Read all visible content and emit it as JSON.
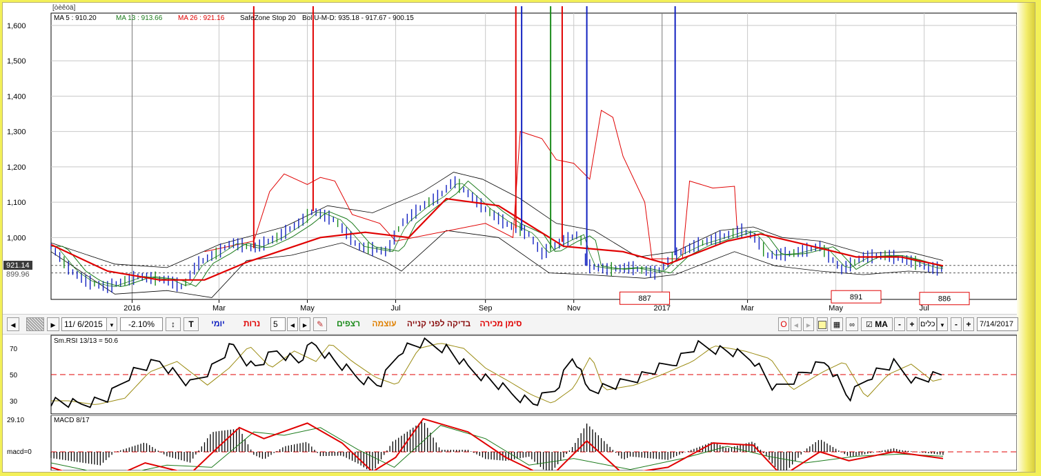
{
  "header": {
    "title": "[òèêöä]",
    "ma5": "MA 5 : 910.20",
    "ma13": "MA 13 : 913.66",
    "ma26": "MA 26 : 921.16",
    "safezone": "SafeZone Stop 20",
    "bol": "Bol U-M-D: 935.18 - 917.67 - 900.15"
  },
  "price_labels": {
    "last": "921.14",
    "low": "899.96"
  },
  "toolbar": {
    "date_from": "11/ 6/2015",
    "change": "-2.10%",
    "t_label": "T",
    "daily": "יומי",
    "candles": "נרות",
    "period": "5",
    "continuous": "רצפים",
    "strength": "עוצמה",
    "pre_buy_check": "בדיקה לפני קנייה",
    "sell_sign": "סימן מכירה",
    "o_label": "O",
    "ma_label": "MA",
    "minus": "-",
    "plus": "+",
    "tools": "כלים",
    "date_to": "7/14/2017",
    "nav_left": "◀",
    "nav_right": "▶"
  },
  "colors": {
    "ma5": "#1a7a1a",
    "ma13": "#1a7a1a",
    "ma26": "#e00000",
    "bar": "#1020c0",
    "bar_alt": "#1a8a1a",
    "safezone": "#e00000",
    "bollinger": "#000000"
  },
  "chart_data": [
    {
      "type": "line",
      "panel": "price",
      "yticks": [
        1600,
        1500,
        1400,
        1300,
        1200,
        1100,
        1000
      ],
      "ytick_labels": [
        "1,600",
        "1,500",
        "1,400",
        "1,300",
        "1,200",
        "1,100",
        "1,000"
      ],
      "ylim": [
        825,
        1635
      ],
      "x_labels": [
        {
          "label": "2016",
          "date": "2016-01-01"
        },
        {
          "label": "Mar",
          "date": "2016-03-01"
        },
        {
          "label": "May",
          "date": "2016-05-01"
        },
        {
          "label": "Jul",
          "date": "2016-07-01"
        },
        {
          "label": "Sep",
          "date": "2016-09-01"
        },
        {
          "label": "Nov",
          "date": "2016-11-01"
        },
        {
          "label": "2017",
          "date": "2017-01-01"
        },
        {
          "label": "Mar",
          "date": "2017-03-01"
        },
        {
          "label": "May",
          "date": "2017-05-01"
        },
        {
          "label": "Jul",
          "date": "2017-07-01"
        }
      ],
      "xlim": [
        "2015-11-06",
        "2017-09-03"
      ],
      "close": [
        [
          "2015-11-06",
          975
        ],
        [
          "2015-11-20",
          905
        ],
        [
          "2015-12-01",
          875
        ],
        [
          "2015-12-15",
          860
        ],
        [
          "2016-01-05",
          890
        ],
        [
          "2016-01-25",
          880
        ],
        [
          "2016-02-05",
          860
        ],
        [
          "2016-02-15",
          925
        ],
        [
          "2016-02-28",
          955
        ],
        [
          "2016-03-10",
          985
        ],
        [
          "2016-03-25",
          970
        ],
        [
          "2016-04-10",
          1000
        ],
        [
          "2016-04-25",
          1040
        ],
        [
          "2016-05-05",
          1075
        ],
        [
          "2016-05-20",
          1050
        ],
        [
          "2016-06-05",
          975
        ],
        [
          "2016-06-25",
          960
        ],
        [
          "2016-07-05",
          1040
        ],
        [
          "2016-07-20",
          1090
        ],
        [
          "2016-08-01",
          1120
        ],
        [
          "2016-08-10",
          1160
        ],
        [
          "2016-08-20",
          1125
        ],
        [
          "2016-09-01",
          1080
        ],
        [
          "2016-09-15",
          1040
        ],
        [
          "2016-10-01",
          1010
        ],
        [
          "2016-10-10",
          955
        ],
        [
          "2016-10-25",
          990
        ],
        [
          "2016-11-05",
          1010
        ],
        [
          "2016-11-10",
          920
        ],
        [
          "2016-11-25",
          910
        ],
        [
          "2016-12-10",
          915
        ],
        [
          "2016-12-28",
          900
        ],
        [
          "2017-01-10",
          950
        ],
        [
          "2017-01-25",
          980
        ],
        [
          "2017-02-10",
          1000
        ],
        [
          "2017-02-25",
          1020
        ],
        [
          "2017-03-05",
          1005
        ],
        [
          "2017-03-15",
          950
        ],
        [
          "2017-04-01",
          955
        ],
        [
          "2017-04-20",
          975
        ],
        [
          "2017-05-05",
          910
        ],
        [
          "2017-05-20",
          945
        ],
        [
          "2017-06-05",
          950
        ],
        [
          "2017-06-20",
          935
        ],
        [
          "2017-07-05",
          915
        ],
        [
          "2017-07-14",
          910
        ]
      ],
      "ma26": [
        [
          "2015-11-06",
          980
        ],
        [
          "2015-12-15",
          905
        ],
        [
          "2016-01-20",
          880
        ],
        [
          "2016-02-20",
          880
        ],
        [
          "2016-03-20",
          930
        ],
        [
          "2016-05-10",
          1000
        ],
        [
          "2016-06-10",
          1015
        ],
        [
          "2016-07-10",
          1000
        ],
        [
          "2016-08-05",
          1110
        ],
        [
          "2016-09-10",
          1090
        ],
        [
          "2016-10-25",
          975
        ],
        [
          "2016-12-05",
          960
        ],
        [
          "2017-01-05",
          925
        ],
        [
          "2017-02-15",
          990
        ],
        [
          "2017-03-10",
          1010
        ],
        [
          "2017-04-10",
          980
        ],
        [
          "2017-05-15",
          945
        ],
        [
          "2017-06-15",
          945
        ],
        [
          "2017-07-14",
          920
        ]
      ],
      "bollinger_upper": [
        [
          "2015-11-06",
          985
        ],
        [
          "2015-12-20",
          925
        ],
        [
          "2016-01-25",
          915
        ],
        [
          "2016-03-01",
          980
        ],
        [
          "2016-04-15",
          1030
        ],
        [
          "2016-05-15",
          1090
        ],
        [
          "2016-06-15",
          1070
        ],
        [
          "2016-07-20",
          1130
        ],
        [
          "2016-08-10",
          1185
        ],
        [
          "2016-08-30",
          1165
        ],
        [
          "2016-09-25",
          1110
        ],
        [
          "2016-10-20",
          1040
        ],
        [
          "2016-11-15",
          1020
        ],
        [
          "2016-12-15",
          945
        ],
        [
          "2017-01-10",
          960
        ],
        [
          "2017-02-10",
          1020
        ],
        [
          "2017-03-05",
          1030
        ],
        [
          "2017-03-25",
          1000
        ],
        [
          "2017-04-20",
          990
        ],
        [
          "2017-05-20",
          955
        ],
        [
          "2017-06-20",
          960
        ],
        [
          "2017-07-14",
          935
        ]
      ],
      "bollinger_lower": [
        [
          "2015-11-06",
          960
        ],
        [
          "2015-12-20",
          840
        ],
        [
          "2016-01-25",
          850
        ],
        [
          "2016-02-25",
          830
        ],
        [
          "2016-03-20",
          935
        ],
        [
          "2016-04-20",
          950
        ],
        [
          "2016-05-25",
          985
        ],
        [
          "2016-06-25",
          930
        ],
        [
          "2016-07-05",
          905
        ],
        [
          "2016-08-05",
          1020
        ],
        [
          "2016-09-10",
          1000
        ],
        [
          "2016-10-15",
          900
        ],
        [
          "2016-11-10",
          895
        ],
        [
          "2016-12-20",
          885
        ],
        [
          "2017-01-10",
          895
        ],
        [
          "2017-02-20",
          960
        ],
        [
          "2017-03-20",
          920
        ],
        [
          "2017-04-20",
          905
        ],
        [
          "2017-05-20",
          895
        ],
        [
          "2017-06-20",
          905
        ],
        [
          "2017-07-14",
          900
        ]
      ],
      "safezone_stop": [
        [
          "2016-02-20",
          960
        ],
        [
          "2016-03-25",
          990
        ],
        [
          "2016-04-05",
          1130
        ],
        [
          "2016-04-15",
          1180
        ],
        [
          "2016-05-01",
          1150
        ],
        [
          "2016-05-10",
          1170
        ],
        [
          "2016-05-20",
          1160
        ],
        [
          "2016-06-01",
          1065
        ],
        [
          "2016-06-20",
          1040
        ],
        [
          "2016-07-01",
          990
        ],
        [
          "2016-09-01",
          1040
        ],
        [
          "2016-09-20",
          1000
        ],
        [
          "2016-09-25",
          1300
        ],
        [
          "2016-10-10",
          1280
        ],
        [
          "2016-10-20",
          1220
        ],
        [
          "2016-11-01",
          1210
        ],
        [
          "2016-11-12",
          1165
        ],
        [
          "2016-11-20",
          1360
        ],
        [
          "2016-11-28",
          1340
        ],
        [
          "2016-12-05",
          1230
        ],
        [
          "2016-12-20",
          1100
        ],
        [
          "2016-12-25",
          940
        ],
        [
          "2017-01-15",
          940
        ],
        [
          "2017-01-20",
          1160
        ],
        [
          "2017-02-05",
          1140
        ],
        [
          "2017-02-20",
          1145
        ],
        [
          "2017-02-22",
          1010
        ]
      ],
      "signal_lines": [
        {
          "date": "2016-03-25",
          "color": "#e00000"
        },
        {
          "date": "2016-05-05",
          "color": "#e00000"
        },
        {
          "date": "2016-09-22",
          "color": "#e00000"
        },
        {
          "date": "2016-09-26",
          "color": "#1020c0"
        },
        {
          "date": "2016-10-16",
          "color": "#1a8a1a"
        },
        {
          "date": "2016-10-24",
          "color": "#e00000"
        },
        {
          "date": "2016-11-10",
          "color": "#1020c0"
        },
        {
          "date": "2017-01-10",
          "color": "#1020c0"
        }
      ],
      "annotations": [
        {
          "label": "887",
          "date": "2016-12-20",
          "y": 887
        },
        {
          "label": "891",
          "date": "2017-05-15",
          "y": 891
        },
        {
          "label": "886",
          "date": "2017-07-15",
          "y": 886
        }
      ],
      "dashed_levels": [
        921.14,
        899.96
      ]
    },
    {
      "type": "line",
      "panel": "rsi",
      "title": "Sm.RSI 13/13 = 50.6",
      "yticks": [
        70,
        50,
        30
      ],
      "ylim": [
        20,
        80
      ],
      "reference_level": 50,
      "values": [
        [
          "2015-11-06",
          30
        ],
        [
          "2015-11-25",
          27
        ],
        [
          "2015-12-15",
          32
        ],
        [
          "2016-01-01",
          52
        ],
        [
          "2016-01-20",
          60
        ],
        [
          "2016-02-10",
          42
        ],
        [
          "2016-02-25",
          55
        ],
        [
          "2016-03-10",
          72
        ],
        [
          "2016-03-25",
          55
        ],
        [
          "2016-04-10",
          68
        ],
        [
          "2016-04-25",
          60
        ],
        [
          "2016-05-05",
          74
        ],
        [
          "2016-05-20",
          60
        ],
        [
          "2016-06-05",
          48
        ],
        [
          "2016-06-20",
          42
        ],
        [
          "2016-07-05",
          70
        ],
        [
          "2016-07-20",
          74
        ],
        [
          "2016-08-05",
          70
        ],
        [
          "2016-08-20",
          55
        ],
        [
          "2016-09-05",
          45
        ],
        [
          "2016-09-20",
          35
        ],
        [
          "2016-10-05",
          28
        ],
        [
          "2016-10-20",
          40
        ],
        [
          "2016-11-01",
          65
        ],
        [
          "2016-11-10",
          38
        ],
        [
          "2016-12-01",
          42
        ],
        [
          "2016-12-20",
          50
        ],
        [
          "2017-01-10",
          60
        ],
        [
          "2017-01-25",
          72
        ],
        [
          "2017-02-15",
          68
        ],
        [
          "2017-03-05",
          62
        ],
        [
          "2017-03-20",
          38
        ],
        [
          "2017-04-10",
          52
        ],
        [
          "2017-04-25",
          60
        ],
        [
          "2017-05-10",
          32
        ],
        [
          "2017-05-25",
          50
        ],
        [
          "2017-06-10",
          58
        ],
        [
          "2017-06-25",
          45
        ],
        [
          "2017-07-14",
          50
        ]
      ]
    },
    {
      "type": "bar",
      "panel": "macd",
      "title": "MACD 8/17",
      "ytick_labels": [
        "29.10",
        "macd=0"
      ],
      "zero_level": 0,
      "macd_line": [
        [
          "2015-11-06",
          -14
        ],
        [
          "2015-12-10",
          -28
        ],
        [
          "2016-01-10",
          -10
        ],
        [
          "2016-02-10",
          -20
        ],
        [
          "2016-03-01",
          5
        ],
        [
          "2016-03-15",
          22
        ],
        [
          "2016-04-01",
          12
        ],
        [
          "2016-05-01",
          26
        ],
        [
          "2016-05-25",
          8
        ],
        [
          "2016-06-15",
          -18
        ],
        [
          "2016-07-01",
          -5
        ],
        [
          "2016-07-20",
          30
        ],
        [
          "2016-08-20",
          18
        ],
        [
          "2016-09-15",
          -5
        ],
        [
          "2016-10-15",
          -24
        ],
        [
          "2016-11-10",
          10
        ],
        [
          "2016-12-05",
          -20
        ],
        [
          "2017-01-05",
          -14
        ],
        [
          "2017-02-05",
          8
        ],
        [
          "2017-03-05",
          6
        ],
        [
          "2017-03-25",
          -22
        ],
        [
          "2017-04-20",
          0
        ],
        [
          "2017-05-10",
          -8
        ],
        [
          "2017-06-10",
          0
        ],
        [
          "2017-07-14",
          -6
        ]
      ],
      "signal_line": [
        [
          "2015-11-06",
          -10
        ],
        [
          "2015-12-20",
          -22
        ],
        [
          "2016-01-25",
          -12
        ],
        [
          "2016-02-25",
          -14
        ],
        [
          "2016-03-25",
          18
        ],
        [
          "2016-04-15",
          15
        ],
        [
          "2016-05-10",
          22
        ],
        [
          "2016-06-05",
          2
        ],
        [
          "2016-06-30",
          -14
        ],
        [
          "2016-08-01",
          24
        ],
        [
          "2016-09-01",
          12
        ],
        [
          "2016-10-01",
          -12
        ],
        [
          "2016-11-01",
          -6
        ],
        [
          "2016-12-10",
          -16
        ],
        [
          "2017-01-15",
          -6
        ],
        [
          "2017-02-15",
          5
        ],
        [
          "2017-03-15",
          -4
        ],
        [
          "2017-04-10",
          -10
        ],
        [
          "2017-05-15",
          -4
        ],
        [
          "2017-06-15",
          -2
        ],
        [
          "2017-07-14",
          -4
        ]
      ]
    }
  ]
}
